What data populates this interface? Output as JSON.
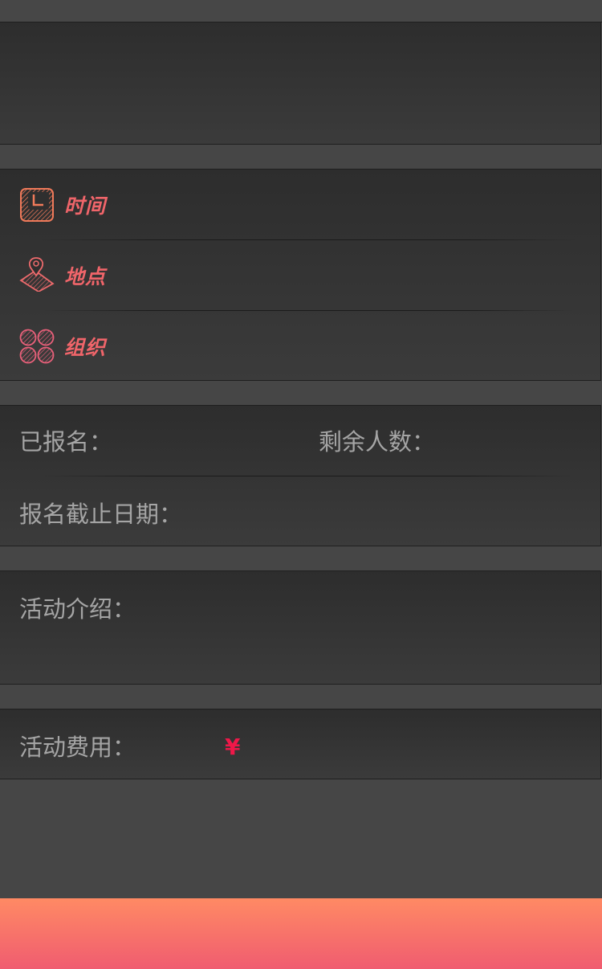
{
  "event": {
    "time_label": "时间",
    "place_label": "地点",
    "organizer_label": "组织"
  },
  "signup": {
    "registered_label": "已报名：",
    "remaining_label": "剩余人数：",
    "deadline_label": "报名截止日期："
  },
  "intro": {
    "label": "活动介绍："
  },
  "fee": {
    "label": "活动费用：",
    "currency_symbol": "¥"
  },
  "colors": {
    "accent": "#f0656a",
    "price": "#ef1849",
    "button_top": "#ff8a64",
    "button_bottom": "#f05c70"
  },
  "icons": [
    "clock-icon",
    "location-pin-icon",
    "organizer-icon"
  ]
}
